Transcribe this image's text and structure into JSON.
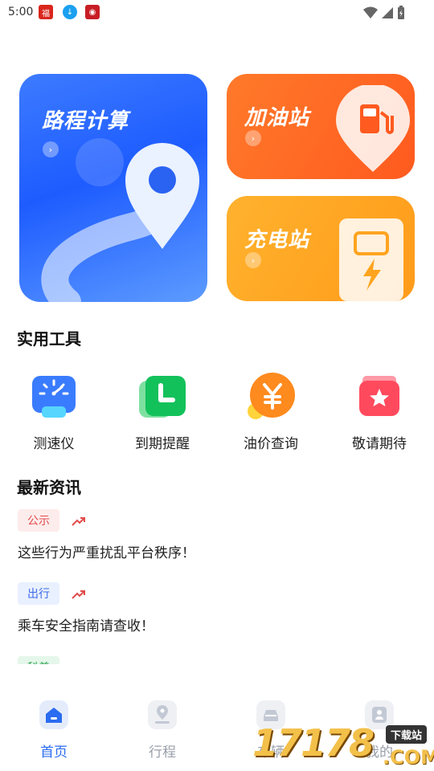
{
  "status_bar": {
    "time": "5:00"
  },
  "cards": {
    "route": {
      "title": "路程计算"
    },
    "gas": {
      "title": "加油站"
    },
    "charge": {
      "title": "充电站"
    }
  },
  "tools_section": {
    "title": "实用工具",
    "items": [
      {
        "label": "测速仪",
        "icon": "speedometer-icon"
      },
      {
        "label": "到期提醒",
        "icon": "clock-icon"
      },
      {
        "label": "油价查询",
        "icon": "yuan-coin-icon"
      },
      {
        "label": "敬请期待",
        "icon": "star-gift-icon"
      }
    ]
  },
  "news_section": {
    "title": "最新资讯",
    "items": [
      {
        "tag": "公示",
        "text": "这些行为严重扰乱平台秩序！"
      },
      {
        "tag": "出行",
        "text": "乘车安全指南请查收！"
      },
      {
        "tag": "科普",
        "text": ""
      }
    ]
  },
  "tabbar": {
    "items": [
      {
        "label": "首页",
        "icon": "home-icon",
        "active": true
      },
      {
        "label": "行程",
        "icon": "location-pin-icon",
        "active": false
      },
      {
        "label": "车辆",
        "icon": "car-icon",
        "active": false
      },
      {
        "label": "我的",
        "icon": "user-icon",
        "active": false
      }
    ]
  },
  "watermark": {
    "number": "17178",
    "badge": "下载站",
    "suffix": ".COM"
  },
  "colors": {
    "route_card": "#1e5cff",
    "gas_card": "#ff5a1f",
    "charge_card": "#ff9b1a",
    "tab_active": "#2b6cf0"
  }
}
